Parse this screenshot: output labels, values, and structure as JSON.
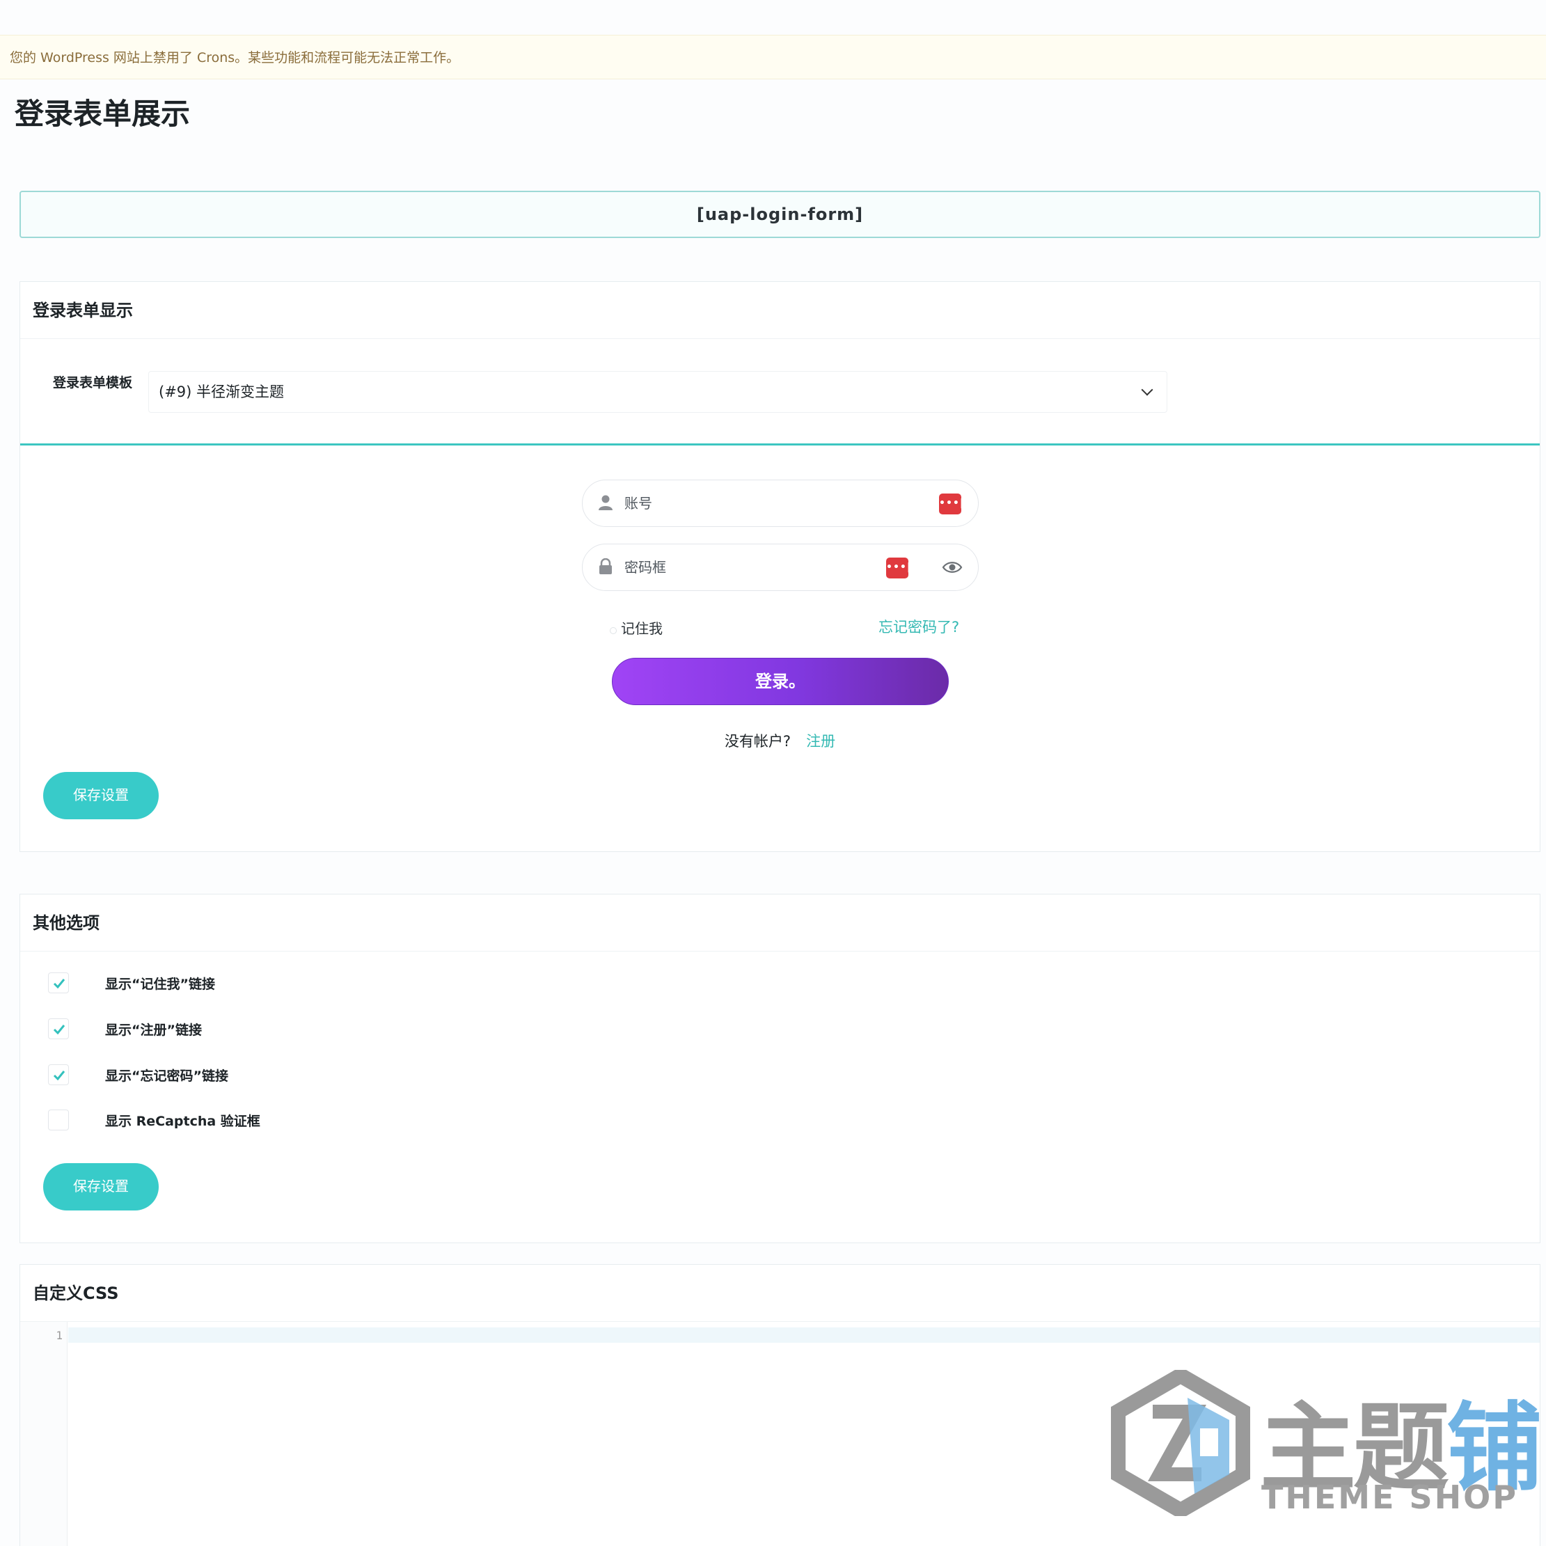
{
  "notice": {
    "text": "您的 WordPress 网站上禁用了 Crons。某些功能和流程可能无法正常工作。"
  },
  "page": {
    "title": "登录表单展示",
    "shortcode": "[uap-login-form]"
  },
  "display_card": {
    "title": "登录表单显示",
    "template_label": "登录表单模板",
    "template_value": "(#9) 半径渐变主题",
    "save_label": "保存设置"
  },
  "preview": {
    "username_placeholder": "账号",
    "password_placeholder": "密码框",
    "pm_badge": "•••|",
    "remember_label": "记住我",
    "forgot_label": "忘记密码了?",
    "login_label": "登录。",
    "no_account": "没有帐户?",
    "register_label": "注册"
  },
  "other_card": {
    "title": "其他选项",
    "options": [
      {
        "label": "显示“记住我”链接",
        "checked": true
      },
      {
        "label": "显示“注册”链接",
        "checked": true
      },
      {
        "label": "显示“忘记密码”链接",
        "checked": true
      },
      {
        "label": "显示 ReCaptcha 验证框",
        "checked": false
      }
    ],
    "save_label": "保存设置"
  },
  "css_card": {
    "title": "自定义CSS",
    "line_number": "1"
  },
  "watermark": {
    "cn_gray": "主题",
    "cn_blue": "铺",
    "en": "THEME SHOP"
  },
  "colors": {
    "accent": "#38cbc9",
    "login_gradient_start": "#a044f5",
    "login_gradient_end": "#6b2ba8",
    "badge_red": "#e0393e"
  }
}
